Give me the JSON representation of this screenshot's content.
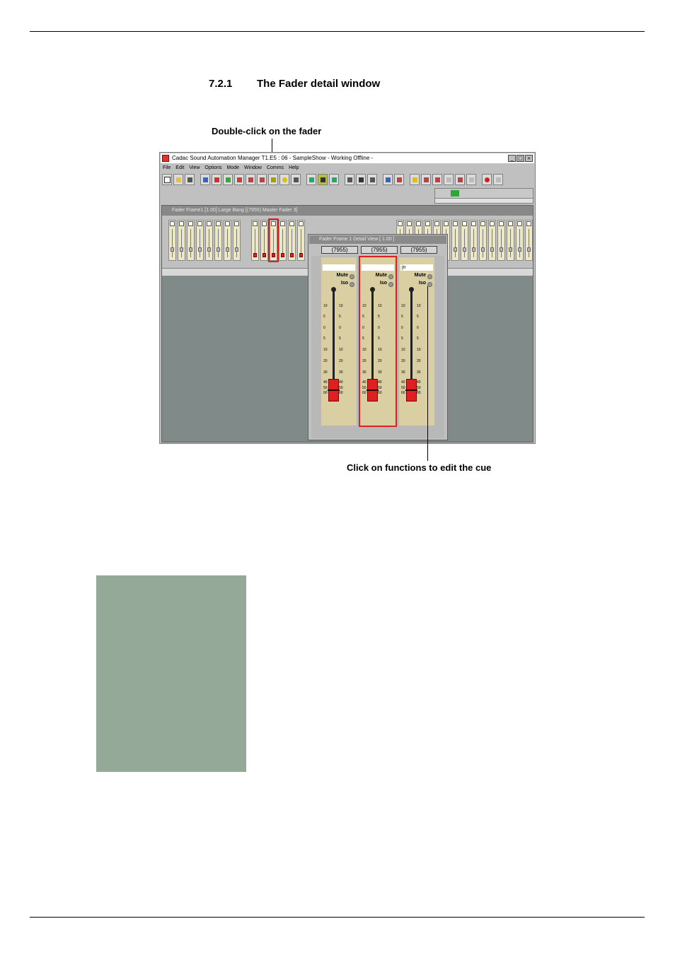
{
  "heading": {
    "number": "7.2.1",
    "title": "The Fader detail window"
  },
  "callouts": {
    "top": "Double-click on the fader",
    "bottom": "Click on functions to edit the cue"
  },
  "app": {
    "title": "Cadac Sound Automation Manager T1.E5 : 06 - SampleShow   - Working Offline -",
    "menu": [
      "File",
      "Edit",
      "View",
      "Options",
      "Mode",
      "Window",
      "Comms",
      "Help"
    ],
    "frame_title": "Fader Frame1 [1.00] Large Bang   [(7955) Master Fader 3]",
    "detail": {
      "title": "Fader Frame 1 Detail View [ 1.00 ]",
      "tabs": [
        "(7955)",
        "(7955)",
        "(7955)"
      ],
      "channel_names": [
        "",
        "",
        "jn"
      ],
      "mute_label": "Mute",
      "iso_label": "Iso",
      "scale": [
        "10",
        "5",
        "0",
        "5",
        "10",
        "20",
        "30",
        "40",
        "50",
        "60"
      ]
    }
  },
  "colors": {
    "grey_box": "#95a999",
    "fader_cap": "#e02020",
    "strip_bg": "#d9cfa3"
  }
}
